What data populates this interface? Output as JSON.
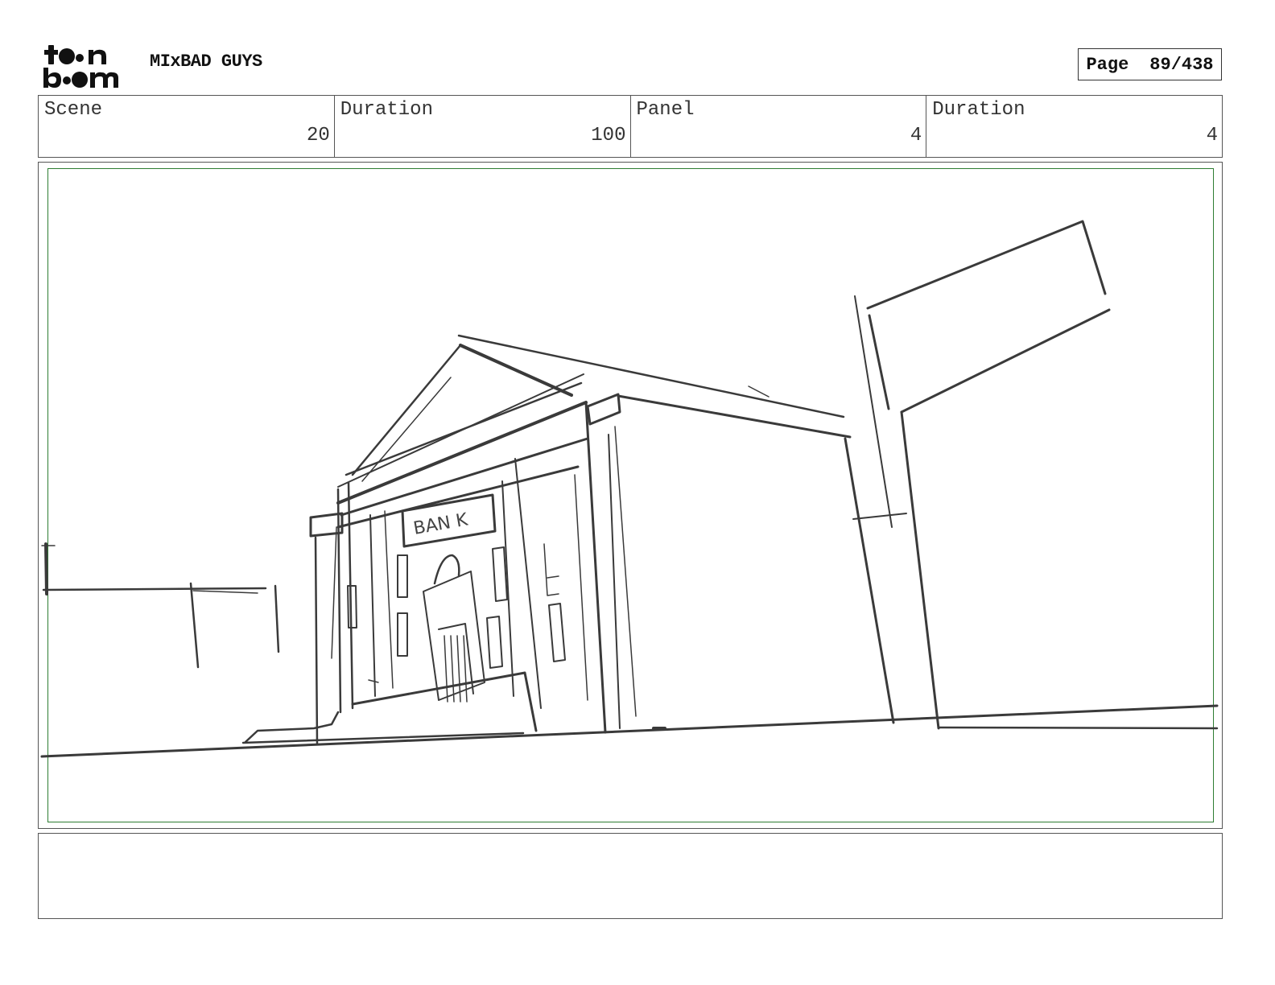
{
  "header": {
    "logo_text": "toon boom",
    "project_title": "MIxBAD GUYS",
    "page_label": "Page",
    "page_value": "89/438"
  },
  "info": [
    {
      "label": "Scene",
      "value": "20"
    },
    {
      "label": "Duration",
      "value": "100"
    },
    {
      "label": "Panel",
      "value": "4"
    },
    {
      "label": "Duration",
      "value": "4"
    }
  ],
  "panel": {
    "sign_text": "BAN K"
  },
  "notes": {
    "text": ""
  },
  "colors": {
    "frame_border": "#2e7d32",
    "sketch_stroke": "#3a3a3a"
  }
}
